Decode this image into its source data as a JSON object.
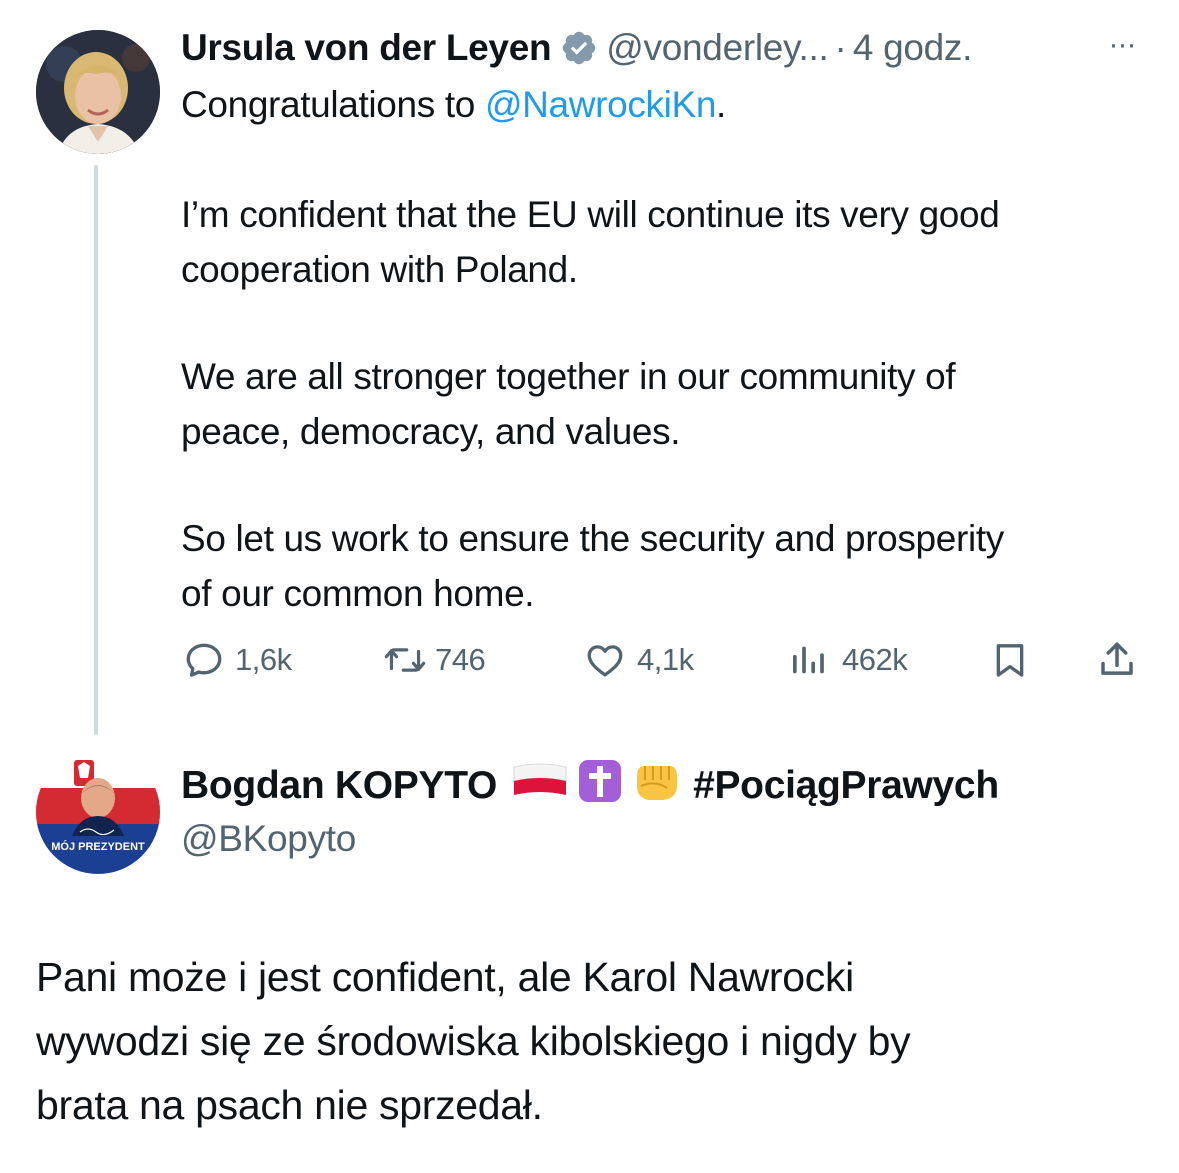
{
  "tweet1": {
    "author_name": "Ursula von der Leyen",
    "handle": "@vonderley...",
    "separator": "·",
    "time": "4 godz.",
    "more_label": "···",
    "text": {
      "line1_prefix": "Congratulations to ",
      "line1_mention": "@NawrockiKn",
      "line1_suffix": ".",
      "para2_line1": "I’m confident that the EU will continue its very good",
      "para2_line2": "cooperation with Poland.",
      "para3_line1": "We are all stronger together in our community of",
      "para3_line2": "peace, democracy, and values.",
      "para4_line1": "So let us work to ensure the security and prosperity",
      "para4_line2": "of our common home."
    },
    "actions": {
      "replies": "1,6k",
      "reposts": "746",
      "likes": "4,1k",
      "views": "462k"
    }
  },
  "tweet2": {
    "author_name": "Bogdan KOPYTO",
    "hashtag": "#PociągPrawych",
    "handle": "@BKopyto",
    "avatar_caption": "MÓJ PREZYDENT",
    "text": {
      "line1": "Pani może i jest confident, ale Karol Nawrocki",
      "line2": "wywodzi się ze środowiska kibolskiego i nigdy by",
      "line3": "brata na psach nie sprzedał."
    }
  },
  "colors": {
    "text": "#0f1419",
    "secondary": "#536471",
    "link": "#1d9bf0",
    "thread_line": "#cfd9de",
    "verified": "#829aab"
  },
  "icons": [
    "verified-badge-icon",
    "more-icon",
    "reply-icon",
    "repost-icon",
    "like-icon",
    "views-icon",
    "bookmark-icon",
    "share-icon",
    "poland-flag-icon",
    "latin-cross-icon",
    "fist-icon"
  ]
}
